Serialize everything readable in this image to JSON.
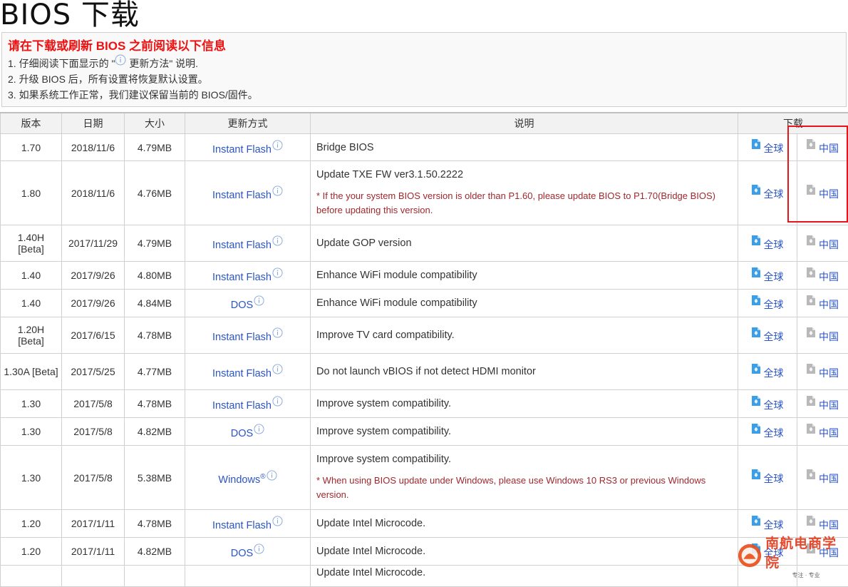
{
  "page": {
    "title": "BIOS 下载"
  },
  "notice": {
    "title": "请在下载或刷新 BIOS 之前阅读以下信息",
    "line1_prefix": "1. 仔细阅读下面显示的 \"",
    "line1_suffix": " 更新方法\" 说明.",
    "line2": "2. 升级 BIOS 后，所有设置将恢复默认设置。",
    "line3": "3. 如果系统工作正常，我们建议保留当前的 BIOS/固件。"
  },
  "table": {
    "headers": [
      "版本",
      "日期",
      "大小",
      "更新方式",
      "说明",
      "下载"
    ],
    "global_label": "全球",
    "china_label": "中国",
    "rows": [
      {
        "version": "1.70",
        "date": "2018/11/6",
        "size": "4.79MB",
        "method": "Instant Flash",
        "desc": "Bridge BIOS",
        "note": ""
      },
      {
        "version": "1.80",
        "date": "2018/11/6",
        "size": "4.76MB",
        "method": "Instant Flash",
        "desc": "Update TXE FW ver3.1.50.2222",
        "note": "* If the your system BIOS version is older than P1.60, please update BIOS to P1.70(Bridge BIOS) before updating this version."
      },
      {
        "version": "1.40H [Beta]",
        "date": "2017/11/29",
        "size": "4.79MB",
        "method": "Instant Flash",
        "desc": "Update GOP version",
        "note": ""
      },
      {
        "version": "1.40",
        "date": "2017/9/26",
        "size": "4.80MB",
        "method": "Instant Flash",
        "desc": "Enhance WiFi module compatibility",
        "note": ""
      },
      {
        "version": "1.40",
        "date": "2017/9/26",
        "size": "4.84MB",
        "method": "DOS",
        "desc": "Enhance WiFi module compatibility",
        "note": ""
      },
      {
        "version": "1.20H [Beta]",
        "date": "2017/6/15",
        "size": "4.78MB",
        "method": "Instant Flash",
        "desc": "Improve TV card compatibility.",
        "note": ""
      },
      {
        "version": "1.30A [Beta]",
        "date": "2017/5/25",
        "size": "4.77MB",
        "method": "Instant Flash",
        "desc": "Do not launch vBIOS if not detect HDMI monitor",
        "note": ""
      },
      {
        "version": "1.30",
        "date": "2017/5/8",
        "size": "4.78MB",
        "method": "Instant Flash",
        "desc": "Improve system compatibility.",
        "note": ""
      },
      {
        "version": "1.30",
        "date": "2017/5/8",
        "size": "4.82MB",
        "method": "DOS",
        "desc": "Improve system compatibility.",
        "note": ""
      },
      {
        "version": "1.30",
        "date": "2017/5/8",
        "size": "5.38MB",
        "method": "Windows",
        "method_sup": "®",
        "desc": "Improve system compatibility.",
        "note": "* When using BIOS update under Windows, please use Windows 10 RS3 or previous Windows version."
      },
      {
        "version": "1.20",
        "date": "2017/1/11",
        "size": "4.78MB",
        "method": "Instant Flash",
        "desc": "Update Intel Microcode.",
        "note": ""
      },
      {
        "version": "1.20",
        "date": "2017/1/11",
        "size": "4.82MB",
        "method": "DOS",
        "desc": "Update Intel Microcode.",
        "note": ""
      },
      {
        "version": "",
        "date": "",
        "size": "",
        "method": "",
        "desc": "Update Intel Microcode.",
        "note": ""
      }
    ]
  },
  "watermark": {
    "main": "南航电商学院",
    "sub": "专注 · 专业"
  },
  "colors": {
    "link": "#2b55c5",
    "notice_title": "#ee1111",
    "note": "#a0282d",
    "highlight": "#e8141b",
    "global_icon": "#3a9ee8",
    "china_icon": "#b9b9b9"
  }
}
